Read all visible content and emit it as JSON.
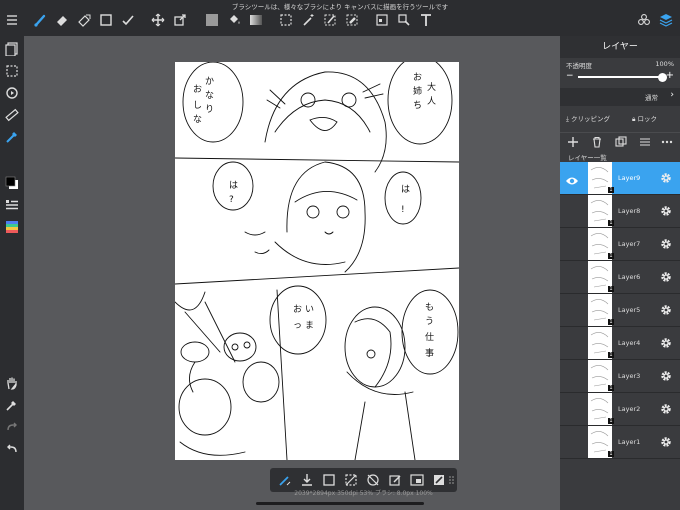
{
  "status_hint": "ブラシツールは、様々なブラシにより キャンバスに描画を行うツールです",
  "panel": {
    "title": "レイヤー",
    "opacity_label": "不透明度",
    "opacity_value": "100%",
    "opacity_fraction": 1.0,
    "blend_mode": "通常",
    "clipping_label": "クリッピング",
    "lock_label": "ロック",
    "list_title": "レイヤー一覧",
    "selected_color": "#3aa3ef"
  },
  "layers": [
    {
      "name": "Layer9",
      "selected": true
    },
    {
      "name": "Layer8"
    },
    {
      "name": "Layer7"
    },
    {
      "name": "Layer6"
    },
    {
      "name": "Layer5"
    },
    {
      "name": "Layer4"
    },
    {
      "name": "Layer3"
    },
    {
      "name": "Layer2"
    },
    {
      "name": "Layer1"
    }
  ],
  "layer_badge": "1",
  "canvas_info": "2039*2894px 350dpi 53% ブラシ: 8.0px 100%",
  "icons": {
    "top": [
      "menu-icon",
      "brush-icon",
      "eraser-icon",
      "fill-eraser-icon",
      "rectangle-icon",
      "select-pen-icon",
      "move-icon",
      "transform-icon",
      "fill-color-icon",
      "bucket-icon",
      "gradient-icon",
      "select-rect-icon",
      "magic-wand-icon",
      "select-pen-2-icon",
      "select-eraser-icon",
      "crop-icon",
      "text-icon",
      "materials-icon",
      "layers-icon"
    ],
    "left": [
      "pages-icon",
      "selection-icon",
      "rotate-icon",
      "ruler-icon",
      "eyedropper-pen-icon",
      "color-swatch-icon",
      "layer-list-icon",
      "palette-icon",
      "hand-icon",
      "dropper-icon",
      "redo-icon",
      "undo-icon"
    ]
  }
}
